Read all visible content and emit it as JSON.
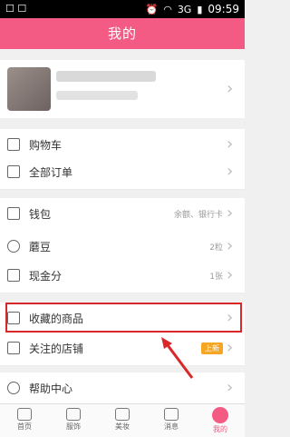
{
  "status": {
    "time": "09:59",
    "network": "3G"
  },
  "title": "我的",
  "rows": {
    "cart": {
      "label": "购物车"
    },
    "orders": {
      "label": "全部订单"
    },
    "wallet": {
      "label": "钱包",
      "value": "余额、银行卡"
    },
    "beans": {
      "label": "蘑豆",
      "value": "2粒"
    },
    "cash": {
      "label": "现金分",
      "value": "1张"
    },
    "fav_goods": {
      "label": "收藏的商品"
    },
    "fav_shops": {
      "label": "关注的店铺",
      "badge": "上新"
    },
    "help": {
      "label": "帮助中心"
    }
  },
  "tabs": [
    {
      "label": "首页"
    },
    {
      "label": "服饰"
    },
    {
      "label": "美妆"
    },
    {
      "label": "消息"
    },
    {
      "label": "我的"
    }
  ],
  "colors": {
    "accent": "#f35a84",
    "highlight": "#d9282a",
    "badge": "#f5a623"
  }
}
